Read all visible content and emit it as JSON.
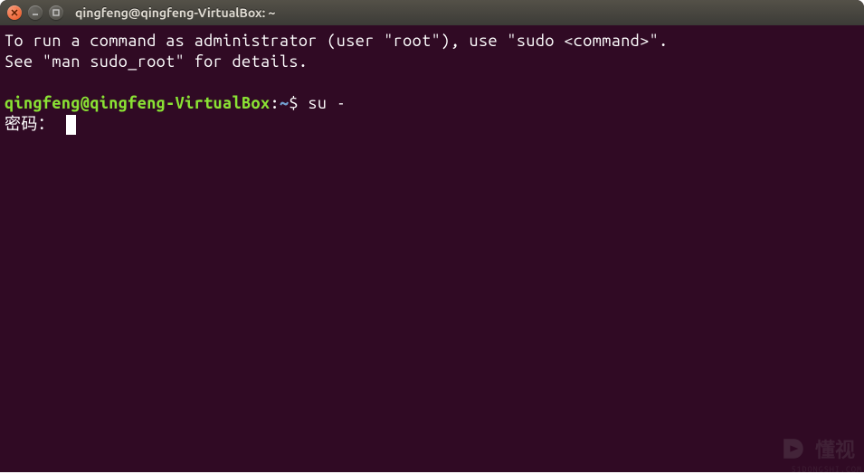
{
  "window": {
    "title": "qingfeng@qingfeng-VirtualBox: ~"
  },
  "terminal": {
    "motd_line1": "To run a command as administrator (user \"root\"), use \"sudo <command>\".",
    "motd_line2": "See \"man sudo_root\" for details.",
    "prompt": {
      "user_host": "qingfeng@qingfeng-VirtualBox",
      "colon": ":",
      "path": "~",
      "symbol": "$ "
    },
    "command": "su -",
    "password_prompt": "密码： "
  },
  "watermark": {
    "text": "懂视",
    "sub": "51DONGSHI.COM"
  }
}
